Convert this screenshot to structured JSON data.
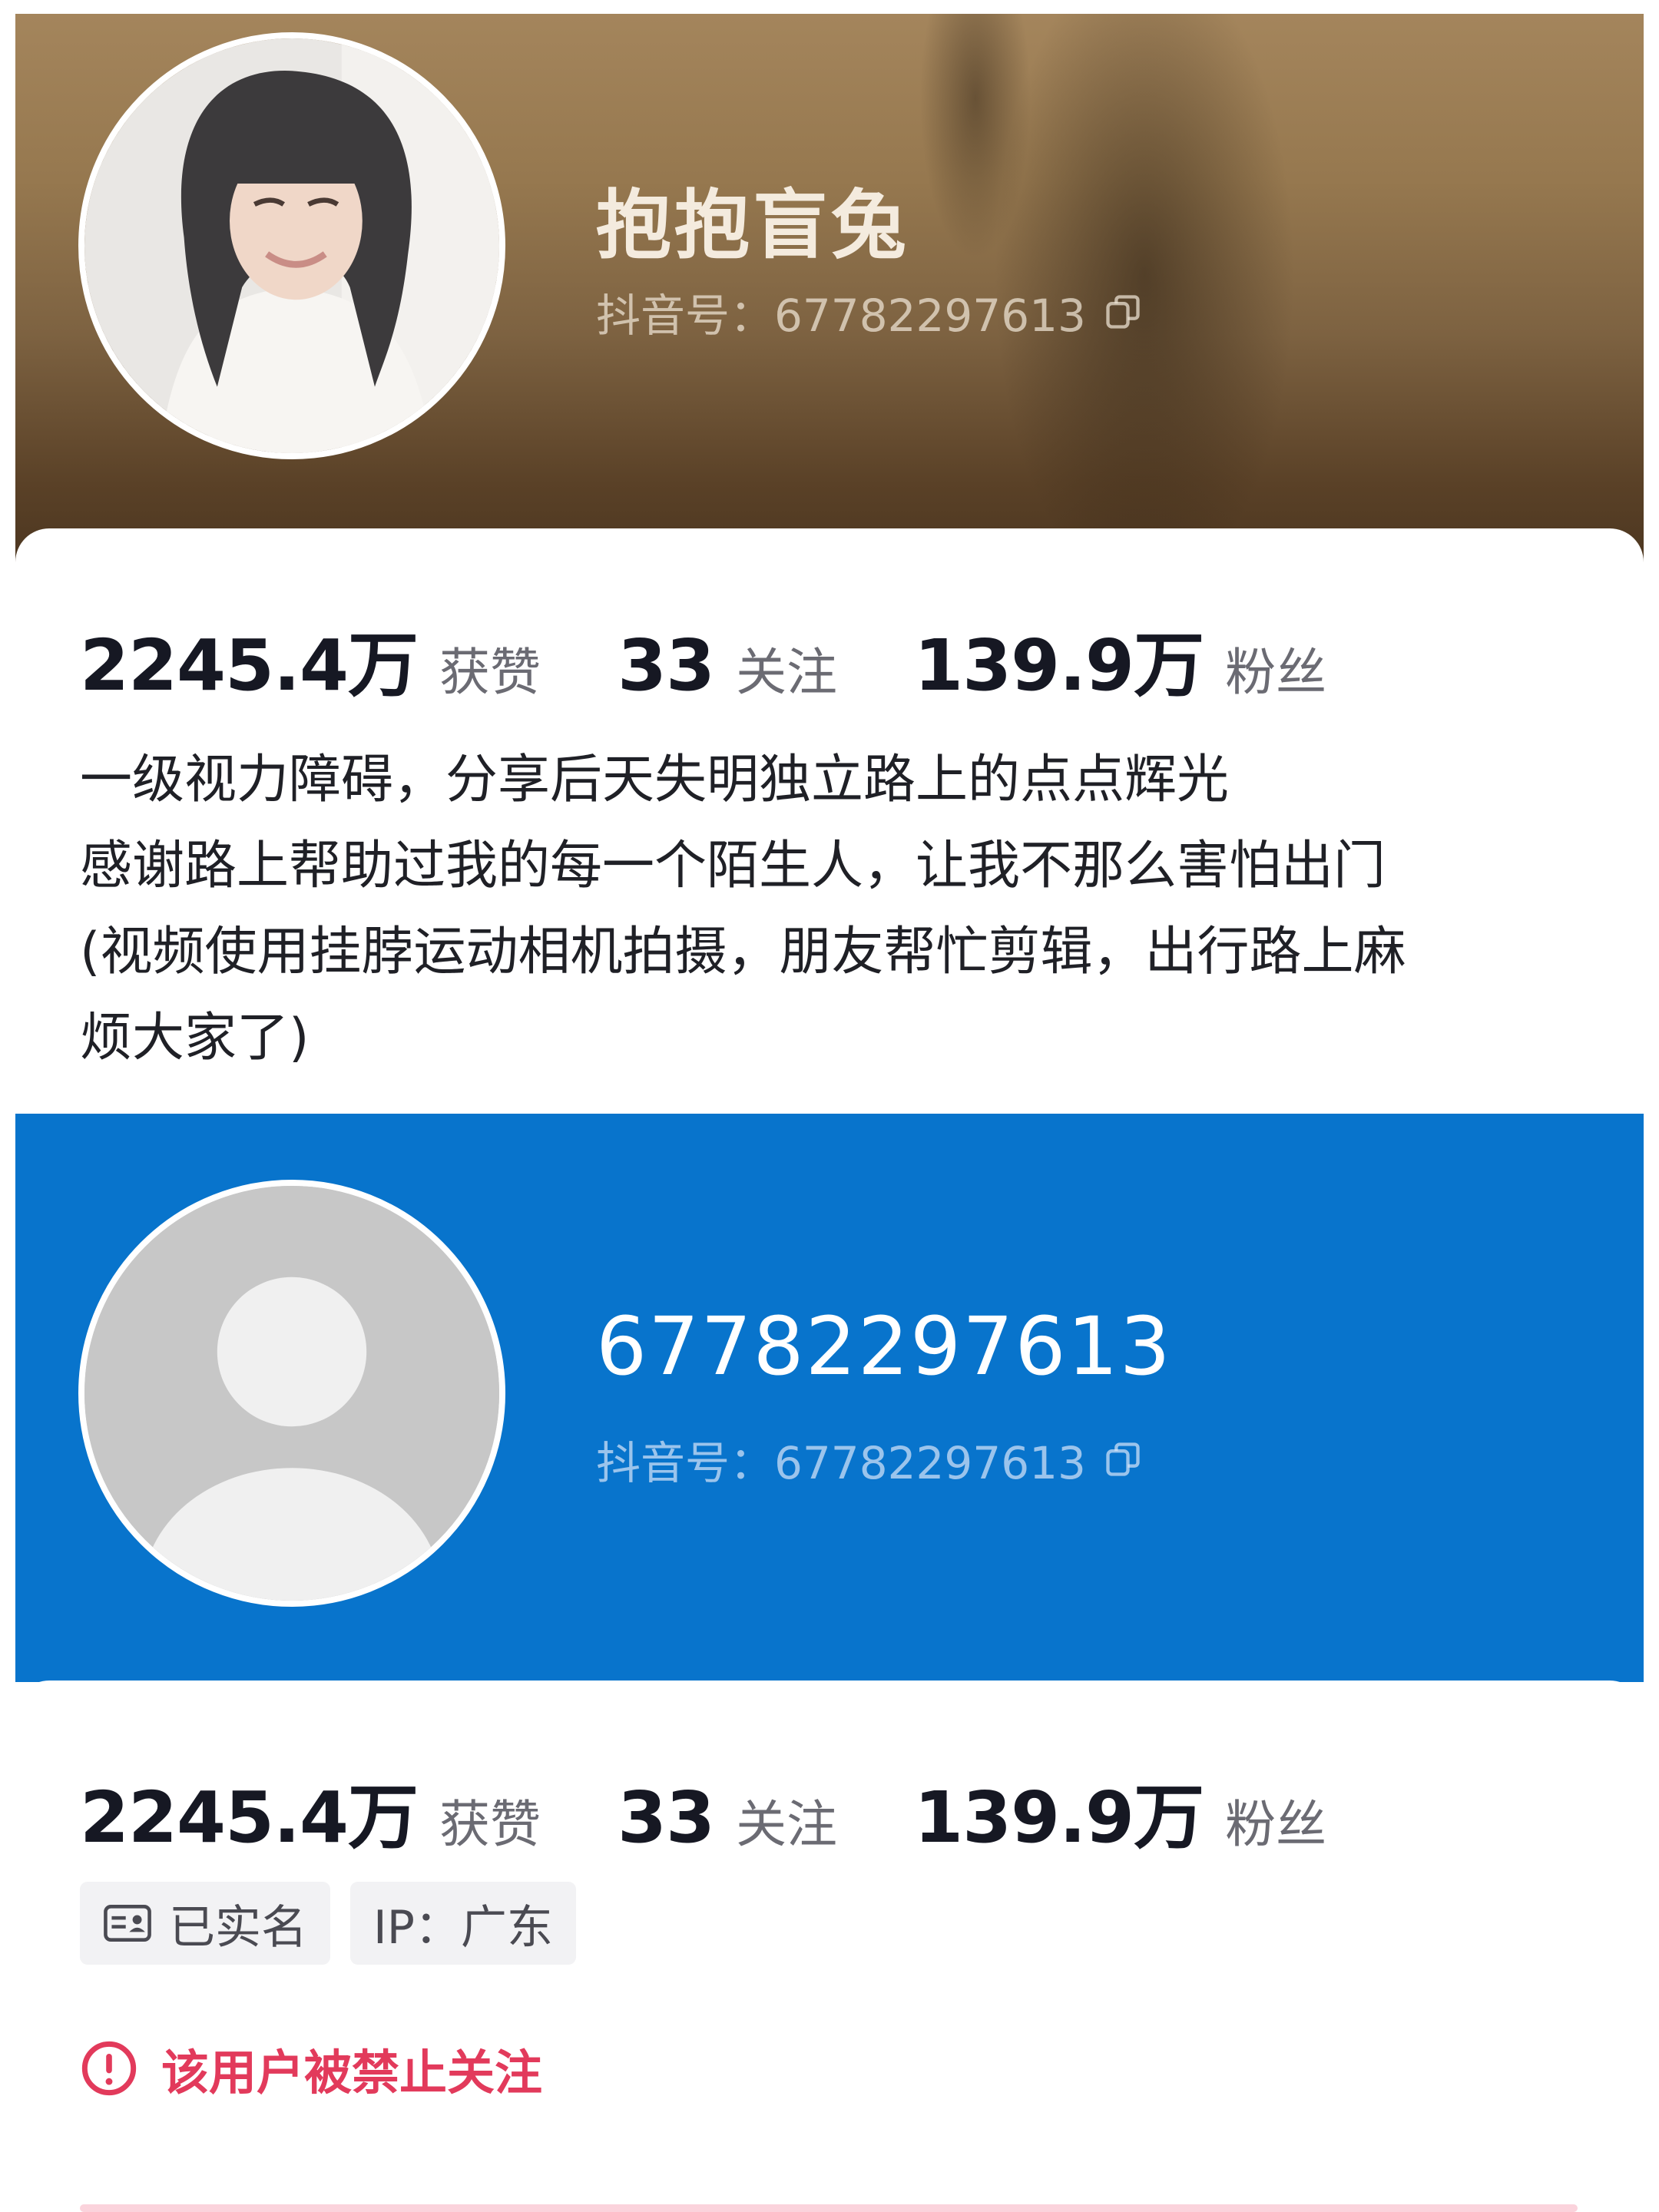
{
  "top_profile": {
    "nickname": "抱抱盲兔",
    "douyin_id": "抖音号：67782297613",
    "stats": [
      {
        "value": "2245.4万",
        "label": "获赞"
      },
      {
        "value": "33",
        "label": "关注"
      },
      {
        "value": "139.9万",
        "label": "粉丝"
      }
    ],
    "bio_lines": [
      "一级视力障碍，分享后天失明独立路上的点点辉光",
      "感谢路上帮助过我的每一个陌生人，让我不那么害怕出门",
      "(视频使用挂脖运动相机拍摄，朋友帮忙剪辑，出行路上麻",
      "烦大家了)"
    ]
  },
  "bottom_profile": {
    "nickname": "67782297613",
    "douyin_id": "抖音号：67782297613",
    "stats": [
      {
        "value": "2245.4万",
        "label": "获赞"
      },
      {
        "value": "33",
        "label": "关注"
      },
      {
        "value": "139.9万",
        "label": "粉丝"
      }
    ],
    "tags": {
      "verified": "已实名",
      "ip": "IP：广东"
    },
    "notice": "该用户被禁止关注"
  },
  "colors": {
    "accent_blue": "#0874cc",
    "notice_red": "#e23a5b",
    "banner_brown": "#8a6c47"
  },
  "icons": [
    "copy-icon",
    "id-card-icon",
    "warning-icon",
    "default-avatar-icon"
  ]
}
